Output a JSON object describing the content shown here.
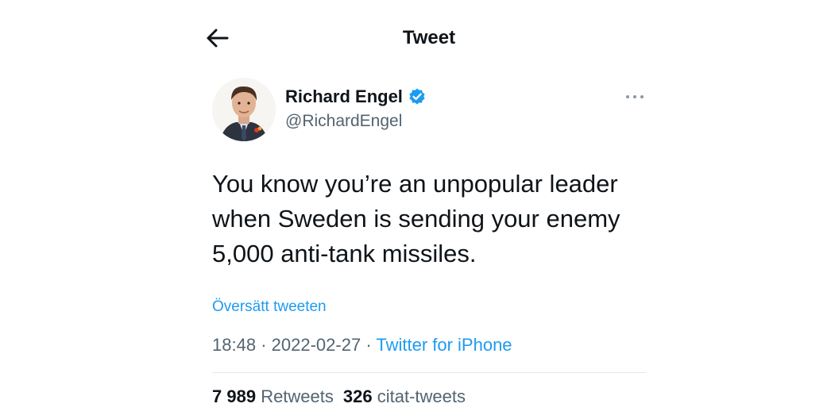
{
  "header": {
    "title": "Tweet"
  },
  "author": {
    "name": "Richard Engel",
    "handle": "@RichardEngel",
    "verified": true
  },
  "tweet": {
    "lines": [
      "You know you’re an unpopular leader",
      "when Sweden is sending your enemy",
      "5,000 anti-tank missiles."
    ]
  },
  "translate_label": "Översätt tweeten",
  "meta": {
    "time": "18:48",
    "separator1": "·",
    "date": "2022-02-27",
    "separator2": "·",
    "source": "Twitter for iPhone"
  },
  "stats": {
    "retweets_count": "7 989",
    "retweets_label": "Retweets",
    "quotes_count": "326",
    "quotes_label": "citat-tweets"
  },
  "colors": {
    "accent": "#1d9bf0",
    "text": "#0f1419",
    "secondary": "#536471"
  },
  "icons": {
    "back": "arrow-left-icon",
    "verified": "verified-badge-icon",
    "more": "more-dots-icon"
  }
}
